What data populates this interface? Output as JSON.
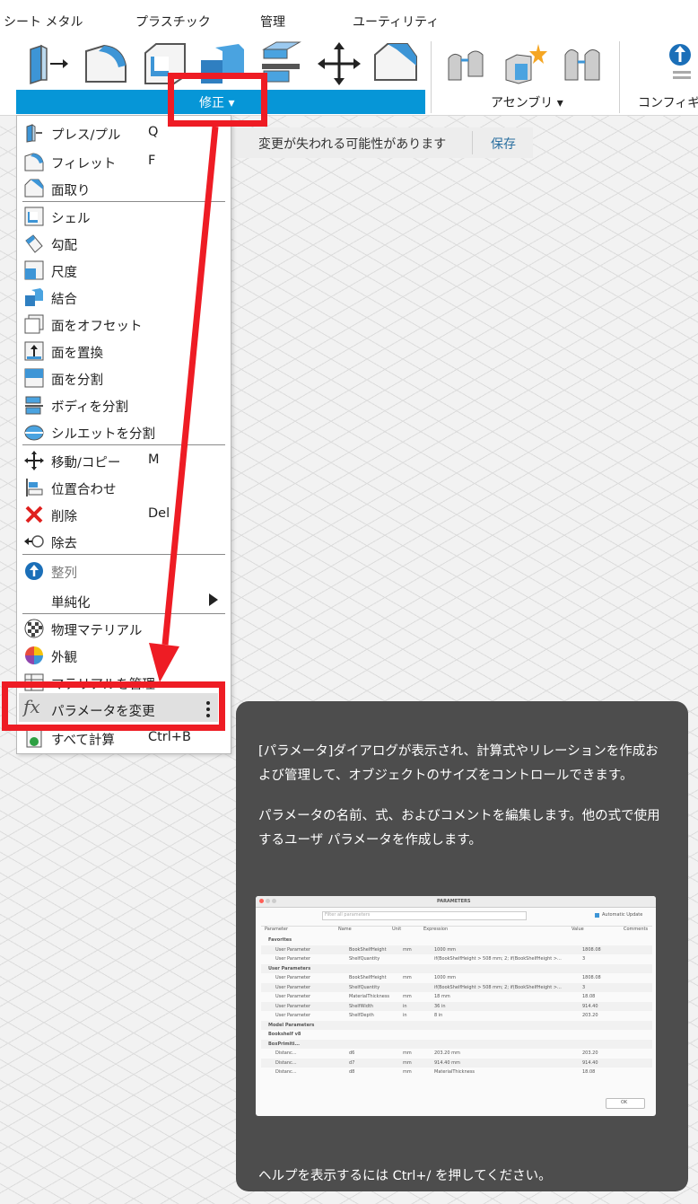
{
  "tabs": [
    "シート メタル",
    "プラスチック",
    "管理",
    "ユーティリティ"
  ],
  "toolbar_groups": {
    "modify": "修正 ▾",
    "assembly": "アセンブリ ▾",
    "configure": "コンフィギュ"
  },
  "notice": {
    "text": "変更が失われる可能性があります",
    "save": "保存"
  },
  "menu": [
    {
      "label": "プレス/プル",
      "shortcut": "Q",
      "icon": "press-pull-icon"
    },
    {
      "label": "フィレット",
      "shortcut": "F",
      "icon": "fillet-icon"
    },
    {
      "label": "面取り",
      "shortcut": "",
      "icon": "chamfer-icon"
    },
    {
      "label": "シェル",
      "shortcut": "",
      "icon": "shell-icon"
    },
    {
      "label": "勾配",
      "shortcut": "",
      "icon": "draft-icon"
    },
    {
      "label": "尺度",
      "shortcut": "",
      "icon": "scale-icon"
    },
    {
      "label": "結合",
      "shortcut": "",
      "icon": "combine-icon"
    },
    {
      "label": "面をオフセット",
      "shortcut": "",
      "icon": "offset-face-icon"
    },
    {
      "label": "面を置換",
      "shortcut": "",
      "icon": "replace-face-icon"
    },
    {
      "label": "面を分割",
      "shortcut": "",
      "icon": "split-face-icon"
    },
    {
      "label": "ボディを分割",
      "shortcut": "",
      "icon": "split-body-icon"
    },
    {
      "label": "シルエットを分割",
      "shortcut": "",
      "icon": "silhouette-split-icon"
    },
    {
      "label": "移動/コピー",
      "shortcut": "M",
      "icon": "move-icon"
    },
    {
      "label": "位置合わせ",
      "shortcut": "",
      "icon": "align-icon"
    },
    {
      "label": "削除",
      "shortcut": "Del",
      "icon": "delete-icon"
    },
    {
      "label": "除去",
      "shortcut": "",
      "icon": "remove-icon"
    },
    {
      "label": "整列",
      "shortcut": "",
      "icon": "arrange-icon"
    },
    {
      "label": "単純化",
      "shortcut": "",
      "icon": "submenu-arrow-icon"
    },
    {
      "label": "物理マテリアル",
      "shortcut": "",
      "icon": "physical-material-icon"
    },
    {
      "label": "外観",
      "shortcut": "",
      "icon": "appearance-icon"
    },
    {
      "label": "マテリアルを管理",
      "shortcut": "",
      "icon": "manage-materials-icon"
    },
    {
      "label": "パラメータを変更",
      "shortcut": "",
      "icon": "fx-icon"
    },
    {
      "label": "すべて計算",
      "shortcut": "Ctrl+B",
      "icon": "compute-all-icon"
    }
  ],
  "tooltip": {
    "p1": "[パラメータ]ダイアログが表示され、計算式やリレーションを作成および管理して、オブジェクトのサイズをコントロールできます。",
    "p2": "パラメータの名前、式、およびコメントを編集します。他の式で使用するユーザ パラメータを作成します。",
    "help": "ヘルプを表示するには Ctrl+/ を押してください。"
  },
  "dialog": {
    "title": "PARAMETERS",
    "filter_placeholder": "Filter all parameters",
    "auto_update": "Automatic Update",
    "headers": [
      "Parameter",
      "Name",
      "Unit",
      "Expression",
      "Value",
      "Comments"
    ],
    "rows": [
      [
        "Favorites",
        "",
        "",
        "",
        ""
      ],
      [
        "User Parameter",
        "BookShelfHeight",
        "mm",
        "1000 mm",
        "1808.08"
      ],
      [
        "User Parameter",
        "ShelfQuantity",
        "",
        "if(BookShelfHeight > 508 mm; 2; if(BookShelfHeight >...",
        "3"
      ],
      [
        "User Parameters",
        "",
        "",
        "",
        ""
      ],
      [
        "User Parameter",
        "BookShelfHeight",
        "mm",
        "1000 mm",
        "1808.08"
      ],
      [
        "User Parameter",
        "ShelfQuantity",
        "",
        "if(BookShelfHeight > 508 mm; 2; if(BookShelfHeight >...",
        "3"
      ],
      [
        "User Parameter",
        "MaterialThickness",
        "mm",
        "18 mm",
        "18.08"
      ],
      [
        "User Parameter",
        "ShelfWidth",
        "in",
        "36 in",
        "914.40"
      ],
      [
        "User Parameter",
        "ShelfDepth",
        "in",
        "8 in",
        "203.20"
      ],
      [
        "Model Parameters",
        "",
        "",
        "",
        ""
      ],
      [
        "Bookshelf v8",
        "",
        "",
        "",
        ""
      ],
      [
        "BoxPrimiti...",
        "",
        "",
        "",
        ""
      ],
      [
        "Distanc...",
        "d6",
        "mm",
        "203.20 mm",
        "203.20"
      ],
      [
        "Distanc...",
        "d7",
        "mm",
        "914.40 mm",
        "914.40"
      ],
      [
        "Distanc...",
        "d8",
        "mm",
        "MaterialThickness",
        "18.08"
      ]
    ],
    "ok": "OK"
  }
}
